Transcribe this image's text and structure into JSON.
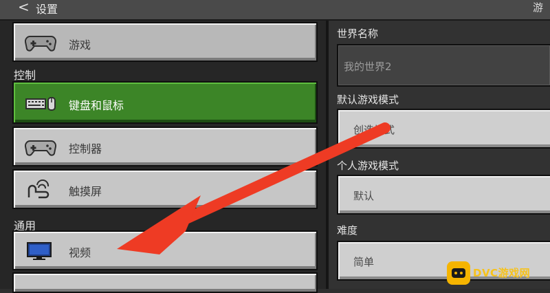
{
  "header": {
    "back_glyph": "<",
    "title": "设置",
    "right_fragment": "游"
  },
  "left": {
    "items_top": [
      {
        "label": "游戏",
        "icon": "gamepad-icon"
      }
    ],
    "sections": [
      {
        "label": "控制"
      },
      {
        "label": "通用"
      }
    ],
    "controls": [
      {
        "label": "键盘和鼠标",
        "icon": "keyboard-mouse-icon",
        "selected": true
      },
      {
        "label": "控制器",
        "icon": "gamepad-icon"
      },
      {
        "label": "触摸屏",
        "icon": "touch-icon"
      }
    ],
    "general": [
      {
        "label": "视频",
        "icon": "monitor-icon"
      }
    ]
  },
  "right": {
    "world_name": {
      "label": "世界名称",
      "value": "我的世界2"
    },
    "default_mode": {
      "label": "默认游戏模式",
      "value": "创造模式"
    },
    "personal_mode": {
      "label": "个人游戏模式",
      "value": "默认"
    },
    "difficulty": {
      "label": "难度",
      "value": "简单"
    }
  },
  "watermark": {
    "text": "DVC游戏网"
  },
  "colors": {
    "selected_green": "#3c8527",
    "button_gray": "#c6c6c6",
    "arrow_red": "#ee3b24"
  }
}
